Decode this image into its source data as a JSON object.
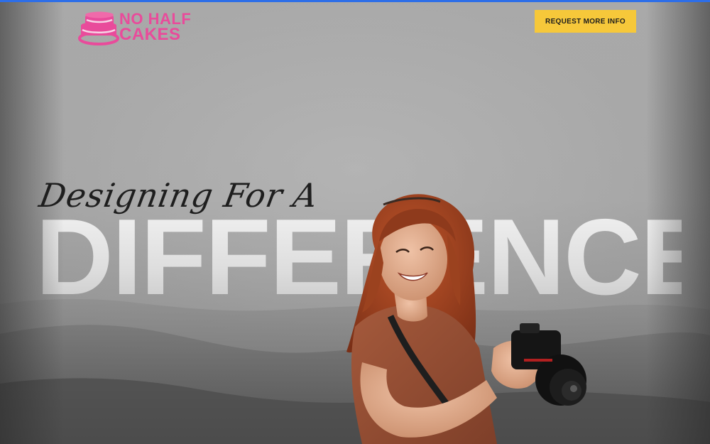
{
  "header": {
    "logo": {
      "line1": "NO HALF",
      "line2": "CAKES",
      "icon": "cake-layers-icon",
      "color": "#e94b9b"
    },
    "cta_label": "REQUEST MORE INFO",
    "cta_color": "#f6c83a"
  },
  "hero": {
    "script_headline": "Designing For A",
    "big_headline": "DIFFERENCE",
    "image": "photographer-woman-with-camera"
  },
  "colors": {
    "top_accent": "#2d6ee8",
    "background": "#a8a8a8"
  }
}
